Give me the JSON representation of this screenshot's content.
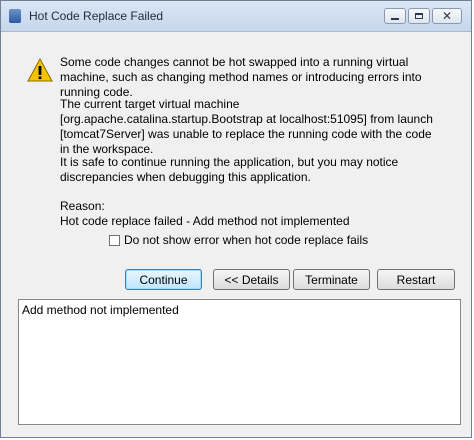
{
  "window": {
    "title": "Hot Code Replace Failed",
    "controls": {
      "minimize": "minimize-icon",
      "maximize": "maximize-icon",
      "close": "close-icon"
    }
  },
  "message": {
    "icon": "warning-icon",
    "para1": "Some code changes cannot be hot swapped into a running virtual machine, such as changing method names or introducing errors into running code.",
    "para2": "The current target virtual machine [org.apache.catalina.startup.Bootstrap at localhost:51095] from launch [tomcat7Server] was unable to replace the running code with the code in the workspace.",
    "para3": "It is safe to continue running the application, but you may notice discrepancies when debugging this application.",
    "reason_label": "Reason:",
    "reason_text": "Hot code replace failed - Add method not implemented"
  },
  "checkbox": {
    "label": "Do not show error when hot code replace fails",
    "checked": false
  },
  "buttons": {
    "continue": "Continue",
    "details": "<< Details",
    "terminate": "Terminate",
    "restart": "Restart"
  },
  "details": {
    "text": "Add method not implemented"
  },
  "colors": {
    "accent": "#3c7fb1",
    "warning": "#f5c400"
  }
}
